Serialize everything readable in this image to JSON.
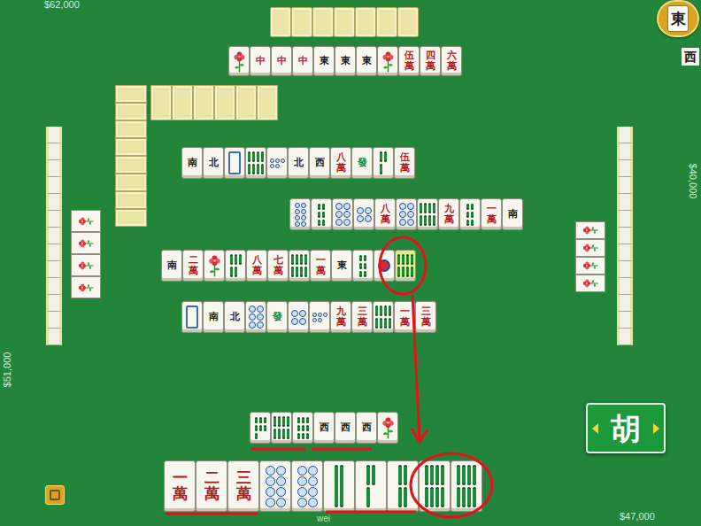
{
  "scores": {
    "top": "$62,000",
    "left": "$51,000",
    "right": "$40,000",
    "bottom": "$47,000"
  },
  "round_wind": "東",
  "seat_wind": "西",
  "hu_button": {
    "label": "胡"
  },
  "player_name": "wei",
  "wall": {
    "row_tiles": 6,
    "column_tiles": 8
  },
  "opponents": {
    "top": {
      "hidden": 7,
      "melds": [
        {
          "kind": "flower"
        },
        {
          "kind": "honor",
          "label": "中",
          "color": "#c8141b"
        },
        {
          "kind": "honor",
          "label": "中",
          "color": "#c8141b"
        },
        {
          "kind": "honor",
          "label": "中",
          "color": "#c8141b"
        },
        {
          "kind": "honor",
          "label": "東",
          "color": "#1a1a1a"
        },
        {
          "kind": "honor",
          "label": "東",
          "color": "#1a1a1a"
        },
        {
          "kind": "honor",
          "label": "東",
          "color": "#1a1a1a"
        },
        {
          "kind": "flower"
        },
        {
          "kind": "man",
          "label": "伍萬"
        },
        {
          "kind": "man",
          "label": "四萬"
        },
        {
          "kind": "man",
          "label": "六萬"
        }
      ]
    },
    "left": {
      "hidden": 13,
      "melds": [
        {
          "kind": "flower"
        },
        {
          "kind": "flower"
        },
        {
          "kind": "flower"
        },
        {
          "kind": "flower"
        }
      ]
    },
    "right": {
      "hidden": 13,
      "melds": [
        {
          "kind": "flower"
        },
        {
          "kind": "flower"
        },
        {
          "kind": "flower"
        },
        {
          "kind": "flower"
        }
      ]
    }
  },
  "discards": [
    [
      {
        "kind": "honor",
        "label": "南",
        "color": "#1a1a1a",
        "highlighted": false
      },
      {
        "kind": "honor",
        "label": "北",
        "color": "#1a1a1a",
        "highlighted": false
      },
      {
        "kind": "blank",
        "highlighted": false
      },
      {
        "kind": "sou",
        "n": 8,
        "highlighted": false
      },
      {
        "kind": "pin",
        "n": 5,
        "highlighted": false
      },
      {
        "kind": "honor",
        "label": "北",
        "color": "#1a1a1a",
        "highlighted": false
      },
      {
        "kind": "honor",
        "label": "西",
        "color": "#1a1a1a",
        "highlighted": false
      },
      {
        "kind": "man",
        "label": "八萬",
        "highlighted": false
      },
      {
        "kind": "honor",
        "label": "發",
        "color": "#168a2e",
        "highlighted": false
      },
      {
        "kind": "sou",
        "n": 3,
        "highlighted": false
      },
      {
        "kind": "man",
        "label": "伍萬",
        "highlighted": false
      }
    ],
    [
      {
        "kind": "pin",
        "n": 8,
        "highlighted": false
      },
      {
        "kind": "sou",
        "n": 6,
        "highlighted": false
      },
      {
        "kind": "pin",
        "n": 6,
        "highlighted": false
      },
      {
        "kind": "pin",
        "n": 4,
        "highlighted": false
      },
      {
        "kind": "man",
        "label": "八萬",
        "highlighted": false
      },
      {
        "kind": "pin",
        "n": 6,
        "highlighted": false
      },
      {
        "kind": "sou",
        "n": 8,
        "highlighted": false
      },
      {
        "kind": "man",
        "label": "九萬",
        "highlighted": false
      },
      {
        "kind": "sou",
        "n": 6,
        "highlighted": false
      },
      {
        "kind": "man",
        "label": "一萬",
        "highlighted": false
      },
      {
        "kind": "honor",
        "label": "南",
        "color": "#1a1a1a",
        "highlighted": false
      }
    ],
    [
      {
        "kind": "honor",
        "label": "南",
        "color": "#1a1a1a",
        "highlighted": false
      },
      {
        "kind": "man",
        "label": "二萬",
        "highlighted": false
      },
      {
        "kind": "flower",
        "highlighted": false
      },
      {
        "kind": "sou",
        "n": 5,
        "highlighted": false
      },
      {
        "kind": "man",
        "label": "八萬",
        "highlighted": false
      },
      {
        "kind": "man",
        "label": "七萬",
        "highlighted": false
      },
      {
        "kind": "sou",
        "n": 8,
        "highlighted": false
      },
      {
        "kind": "man",
        "label": "一萬",
        "highlighted": false
      },
      {
        "kind": "honor",
        "label": "東",
        "color": "#1a1a1a",
        "highlighted": false
      },
      {
        "kind": "sou",
        "n": 6,
        "highlighted": false
      },
      {
        "kind": "pin",
        "n": 1,
        "highlighted": false
      },
      {
        "kind": "sou",
        "n": 8,
        "highlighted": true
      }
    ],
    [
      {
        "kind": "blank",
        "highlighted": false
      },
      {
        "kind": "honor",
        "label": "南",
        "color": "#1a1a1a",
        "highlighted": false
      },
      {
        "kind": "honor",
        "label": "北",
        "color": "#1a1a1a",
        "highlighted": false
      },
      {
        "kind": "pin",
        "n": 6,
        "highlighted": false
      },
      {
        "kind": "honor",
        "label": "發",
        "color": "#168a2e",
        "highlighted": false
      },
      {
        "kind": "pin",
        "n": 4,
        "highlighted": false
      },
      {
        "kind": "pin",
        "n": 5,
        "highlighted": false
      },
      {
        "kind": "man",
        "label": "九萬",
        "highlighted": false
      },
      {
        "kind": "man",
        "label": "三萬",
        "highlighted": false
      },
      {
        "kind": "sou",
        "n": 8,
        "highlighted": false
      },
      {
        "kind": "man",
        "label": "一萬",
        "highlighted": false
      },
      {
        "kind": "man",
        "label": "三萬",
        "highlighted": false
      }
    ]
  ],
  "hand": {
    "melds": [
      {
        "kind": "sou",
        "n": 7
      },
      {
        "kind": "sou",
        "n": 8
      },
      {
        "kind": "sou",
        "n": 9
      },
      {
        "kind": "honor",
        "label": "西",
        "color": "#1a1a1a"
      },
      {
        "kind": "honor",
        "label": "西",
        "color": "#1a1a1a"
      },
      {
        "kind": "honor",
        "label": "西",
        "color": "#1a1a1a"
      },
      {
        "kind": "flower"
      }
    ],
    "concealed": [
      {
        "kind": "man",
        "label": "一萬"
      },
      {
        "kind": "man",
        "label": "二萬"
      },
      {
        "kind": "man",
        "label": "三萬"
      },
      {
        "kind": "pin",
        "n": 8
      },
      {
        "kind": "pin",
        "n": 8
      },
      {
        "kind": "sou",
        "n": 2
      },
      {
        "kind": "sou",
        "n": 3
      },
      {
        "kind": "sou",
        "n": 4
      },
      {
        "kind": "sou",
        "n": 8
      },
      {
        "kind": "sou",
        "n": 8
      }
    ]
  }
}
